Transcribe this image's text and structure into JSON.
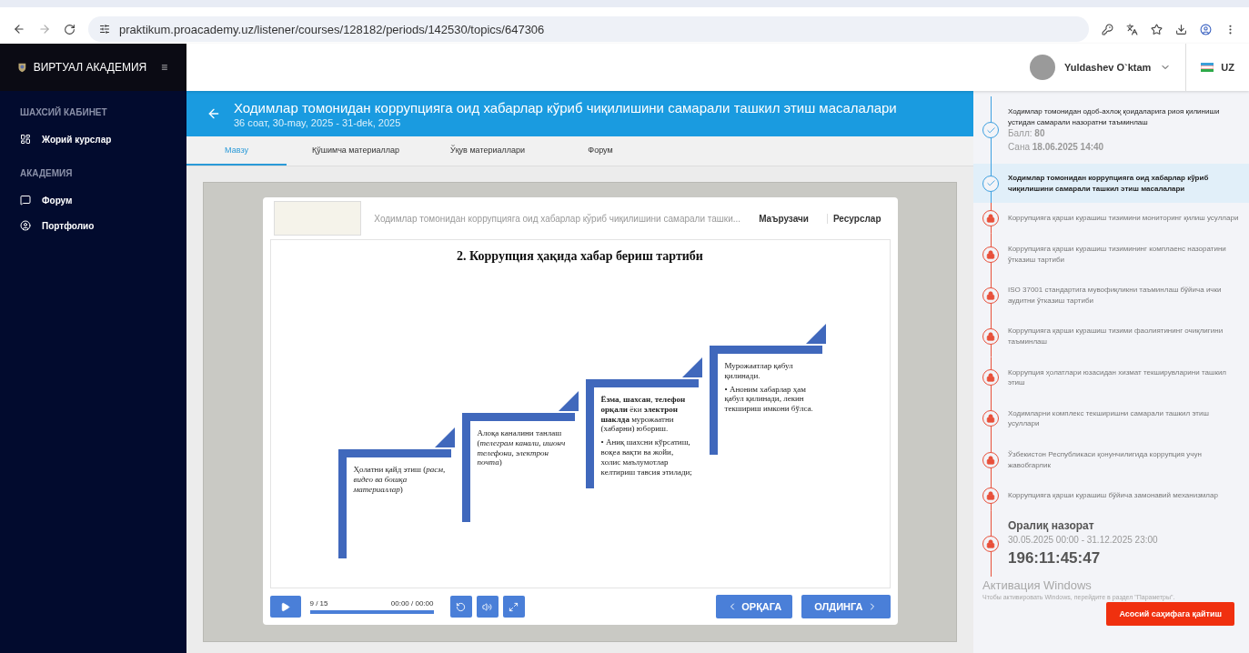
{
  "browser": {
    "url": "praktikum.proacademy.uz/listener/courses/128182/periods/142530/topics/647306"
  },
  "sidebar": {
    "brand": "ВИРТУАЛ АКАДЕМИЯ",
    "sections": [
      {
        "title": "ШАХСИЙ КАБИНЕТ",
        "items": [
          {
            "label": "Жорий курслар",
            "kind": "courses"
          }
        ]
      },
      {
        "title": "АКАДЕМИЯ",
        "items": [
          {
            "label": "Форум",
            "kind": "forum"
          },
          {
            "label": "Портфолио",
            "kind": "portfolio"
          }
        ]
      }
    ]
  },
  "header": {
    "user": "Yuldashev O`ktam",
    "language": "UZ"
  },
  "course": {
    "title": "Ходимлар томонидан коррупцияга оид хабарлар кўриб чиқилишини самарали ташкил этиш масалалари",
    "subtitle": "36 соат, 30-may, 2025 - 31-dek, 2025"
  },
  "tabs": [
    {
      "label": "Мавзу",
      "selected": true
    },
    {
      "label": "Қўшимча материаллар",
      "selected": false
    },
    {
      "label": "Ўқув материаллари",
      "selected": false
    },
    {
      "label": "Форум",
      "selected": false
    }
  ],
  "player": {
    "title": "Ходимлар томонидан коррупцияга оид хабарлар кўриб чиқилишини самарали ташки...",
    "links": [
      "Маърузачи",
      "Ресурслар"
    ],
    "slide": {
      "heading": "2. Коррупция ҳақида хабар бериш тартиби",
      "steps": [
        {
          "text": "Ҳолатни қайд этиш (*расм, видео ва бошқа материаллар*)"
        },
        {
          "text": "Алоқа каналини танлаш (*телеграм канали, ишонч телефони, электрон почта*)"
        },
        {
          "text": "**Ёзма**, **шахсан**, **телефон орқали** ёки **электрон шаклда** мурожаатни (хабарни) юбориш.",
          "bullet": "• Аниқ шахсни кўрсатиш, воқеа вақти ва жойи, холис маълумотлар келтириш тавсия этилади;"
        },
        {
          "text": "Мурожаатлар қабул қилинади.",
          "bullet": "• Аноним хабарлар ҳам қабул қилинади, лекин текшириш имкони бўлса."
        }
      ]
    },
    "counter": "9 / 15",
    "time": "00:00 / 00:00",
    "level": 1,
    "back": "ОРҚАГА",
    "next": "ОЛДИНГА"
  },
  "timeline": [
    {
      "kind": "done",
      "selected": false,
      "title": "Ходимлар томонидан одоб-ахлоқ қоидаларига риоя қилиниши устидан самарали назоратни таъминлаш",
      "score_label": "Балл:",
      "score": "80",
      "date_label": "Сана",
      "date": "18.06.2025 14:40"
    },
    {
      "kind": "done",
      "selected": true,
      "title": "Ходимлар томонидан коррупцияга оид хабарлар кўриб чиқилишини самарали ташкил этиш масалалари"
    },
    {
      "kind": "locked",
      "selected": false,
      "title": "Коррупцияга қарши курашиш тизимини мониторинг қилиш усуллари"
    },
    {
      "kind": "locked",
      "selected": false,
      "title": "Коррупцияга қарши курашиш тизимининг комплаенс назоратини ўтказиш тартиби"
    },
    {
      "kind": "locked",
      "selected": false,
      "title": "ISO 37001 стандартига мувофиқликни таъминлаш бўйича ички аудитни ўтказиш тартиби"
    },
    {
      "kind": "locked",
      "selected": false,
      "title": "Коррупцияга қарши курашиш тизими фаолиятининг очиқлигини таъминлаш"
    },
    {
      "kind": "locked",
      "selected": false,
      "title": "Коррупция ҳолатлари юзасидан хизмат текширувларини ташкил этиш"
    },
    {
      "kind": "locked",
      "selected": false,
      "title": "Ходимларни комплекс текширишни самарали ташкил этиш усуллари"
    },
    {
      "kind": "locked",
      "selected": false,
      "title": "Ўзбекистон Республикаси қонунчилигида коррупция учун жавобгарлик"
    },
    {
      "kind": "locked",
      "selected": false,
      "title": "Коррупцияга қарши курашиш бўйича замонавий механизмлар"
    },
    {
      "kind": "exam",
      "selected": false,
      "title": "Оралиқ назорат",
      "period": "30.05.2025 00:00 - 31.12.2025 23:00",
      "countdown": "196:11:45:47"
    }
  ],
  "home_button": "Асосий саҳифага қайтиш",
  "os_notice": {
    "title": "Активация Windows",
    "text": "Чтобы активировать Windows, перейдите в раздел \"Параметры\"."
  }
}
